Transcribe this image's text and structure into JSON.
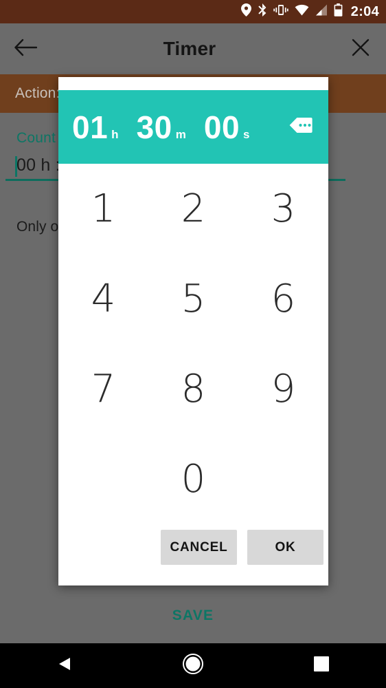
{
  "status_bar": {
    "clock": "2:04",
    "background_color": "#5b2a16",
    "icons": [
      "location-icon",
      "bluetooth-icon",
      "vibrate-icon",
      "wifi-icon",
      "signal-icon",
      "battery-icon"
    ]
  },
  "app_bar": {
    "title": "Timer",
    "back_icon": "arrow-left-icon",
    "close_icon": "close-icon",
    "background_color": "#6b6b6b"
  },
  "content": {
    "action_label": "Action:",
    "count_label": "Count",
    "duration_value": "00 h :",
    "helper_text": "Only o                                  the\ntimer                                     to\nadd a",
    "save_label": "SAVE",
    "accent_color": "#0d7665",
    "action_bar_color": "#703f1d"
  },
  "dialog": {
    "accent_color": "#22c4b4",
    "time": {
      "hours": "01",
      "hours_unit": "h",
      "minutes": "30",
      "minutes_unit": "m",
      "seconds": "00",
      "seconds_unit": "s"
    },
    "backspace_icon": "backspace-icon",
    "keys": [
      "1",
      "2",
      "3",
      "4",
      "5",
      "6",
      "7",
      "8",
      "9",
      "",
      "0",
      ""
    ],
    "cancel_label": "CANCEL",
    "ok_label": "OK"
  },
  "nav_bar": {
    "back_icon": "triangle-back-icon",
    "home_icon": "circle-home-icon",
    "recents_icon": "square-recents-icon"
  }
}
